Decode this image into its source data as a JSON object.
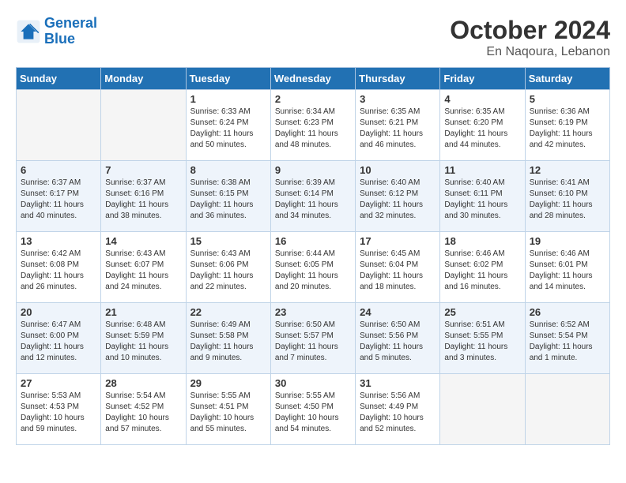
{
  "header": {
    "logo_general": "General",
    "logo_blue": "Blue",
    "month": "October 2024",
    "location": "En Naqoura, Lebanon"
  },
  "days_of_week": [
    "Sunday",
    "Monday",
    "Tuesday",
    "Wednesday",
    "Thursday",
    "Friday",
    "Saturday"
  ],
  "weeks": [
    [
      {
        "day": "",
        "empty": true
      },
      {
        "day": "",
        "empty": true
      },
      {
        "day": "1",
        "sunrise": "6:33 AM",
        "sunset": "6:24 PM",
        "daylight": "11 hours and 50 minutes."
      },
      {
        "day": "2",
        "sunrise": "6:34 AM",
        "sunset": "6:23 PM",
        "daylight": "11 hours and 48 minutes."
      },
      {
        "day": "3",
        "sunrise": "6:35 AM",
        "sunset": "6:21 PM",
        "daylight": "11 hours and 46 minutes."
      },
      {
        "day": "4",
        "sunrise": "6:35 AM",
        "sunset": "6:20 PM",
        "daylight": "11 hours and 44 minutes."
      },
      {
        "day": "5",
        "sunrise": "6:36 AM",
        "sunset": "6:19 PM",
        "daylight": "11 hours and 42 minutes."
      }
    ],
    [
      {
        "day": "6",
        "sunrise": "6:37 AM",
        "sunset": "6:17 PM",
        "daylight": "11 hours and 40 minutes."
      },
      {
        "day": "7",
        "sunrise": "6:37 AM",
        "sunset": "6:16 PM",
        "daylight": "11 hours and 38 minutes."
      },
      {
        "day": "8",
        "sunrise": "6:38 AM",
        "sunset": "6:15 PM",
        "daylight": "11 hours and 36 minutes."
      },
      {
        "day": "9",
        "sunrise": "6:39 AM",
        "sunset": "6:14 PM",
        "daylight": "11 hours and 34 minutes."
      },
      {
        "day": "10",
        "sunrise": "6:40 AM",
        "sunset": "6:12 PM",
        "daylight": "11 hours and 32 minutes."
      },
      {
        "day": "11",
        "sunrise": "6:40 AM",
        "sunset": "6:11 PM",
        "daylight": "11 hours and 30 minutes."
      },
      {
        "day": "12",
        "sunrise": "6:41 AM",
        "sunset": "6:10 PM",
        "daylight": "11 hours and 28 minutes."
      }
    ],
    [
      {
        "day": "13",
        "sunrise": "6:42 AM",
        "sunset": "6:08 PM",
        "daylight": "11 hours and 26 minutes."
      },
      {
        "day": "14",
        "sunrise": "6:43 AM",
        "sunset": "6:07 PM",
        "daylight": "11 hours and 24 minutes."
      },
      {
        "day": "15",
        "sunrise": "6:43 AM",
        "sunset": "6:06 PM",
        "daylight": "11 hours and 22 minutes."
      },
      {
        "day": "16",
        "sunrise": "6:44 AM",
        "sunset": "6:05 PM",
        "daylight": "11 hours and 20 minutes."
      },
      {
        "day": "17",
        "sunrise": "6:45 AM",
        "sunset": "6:04 PM",
        "daylight": "11 hours and 18 minutes."
      },
      {
        "day": "18",
        "sunrise": "6:46 AM",
        "sunset": "6:02 PM",
        "daylight": "11 hours and 16 minutes."
      },
      {
        "day": "19",
        "sunrise": "6:46 AM",
        "sunset": "6:01 PM",
        "daylight": "11 hours and 14 minutes."
      }
    ],
    [
      {
        "day": "20",
        "sunrise": "6:47 AM",
        "sunset": "6:00 PM",
        "daylight": "11 hours and 12 minutes."
      },
      {
        "day": "21",
        "sunrise": "6:48 AM",
        "sunset": "5:59 PM",
        "daylight": "11 hours and 10 minutes."
      },
      {
        "day": "22",
        "sunrise": "6:49 AM",
        "sunset": "5:58 PM",
        "daylight": "11 hours and 9 minutes."
      },
      {
        "day": "23",
        "sunrise": "6:50 AM",
        "sunset": "5:57 PM",
        "daylight": "11 hours and 7 minutes."
      },
      {
        "day": "24",
        "sunrise": "6:50 AM",
        "sunset": "5:56 PM",
        "daylight": "11 hours and 5 minutes."
      },
      {
        "day": "25",
        "sunrise": "6:51 AM",
        "sunset": "5:55 PM",
        "daylight": "11 hours and 3 minutes."
      },
      {
        "day": "26",
        "sunrise": "6:52 AM",
        "sunset": "5:54 PM",
        "daylight": "11 hours and 1 minute."
      }
    ],
    [
      {
        "day": "27",
        "sunrise": "5:53 AM",
        "sunset": "4:53 PM",
        "daylight": "10 hours and 59 minutes."
      },
      {
        "day": "28",
        "sunrise": "5:54 AM",
        "sunset": "4:52 PM",
        "daylight": "10 hours and 57 minutes."
      },
      {
        "day": "29",
        "sunrise": "5:55 AM",
        "sunset": "4:51 PM",
        "daylight": "10 hours and 55 minutes."
      },
      {
        "day": "30",
        "sunrise": "5:55 AM",
        "sunset": "4:50 PM",
        "daylight": "10 hours and 54 minutes."
      },
      {
        "day": "31",
        "sunrise": "5:56 AM",
        "sunset": "4:49 PM",
        "daylight": "10 hours and 52 minutes."
      },
      {
        "day": "",
        "empty": true
      },
      {
        "day": "",
        "empty": true
      }
    ]
  ]
}
